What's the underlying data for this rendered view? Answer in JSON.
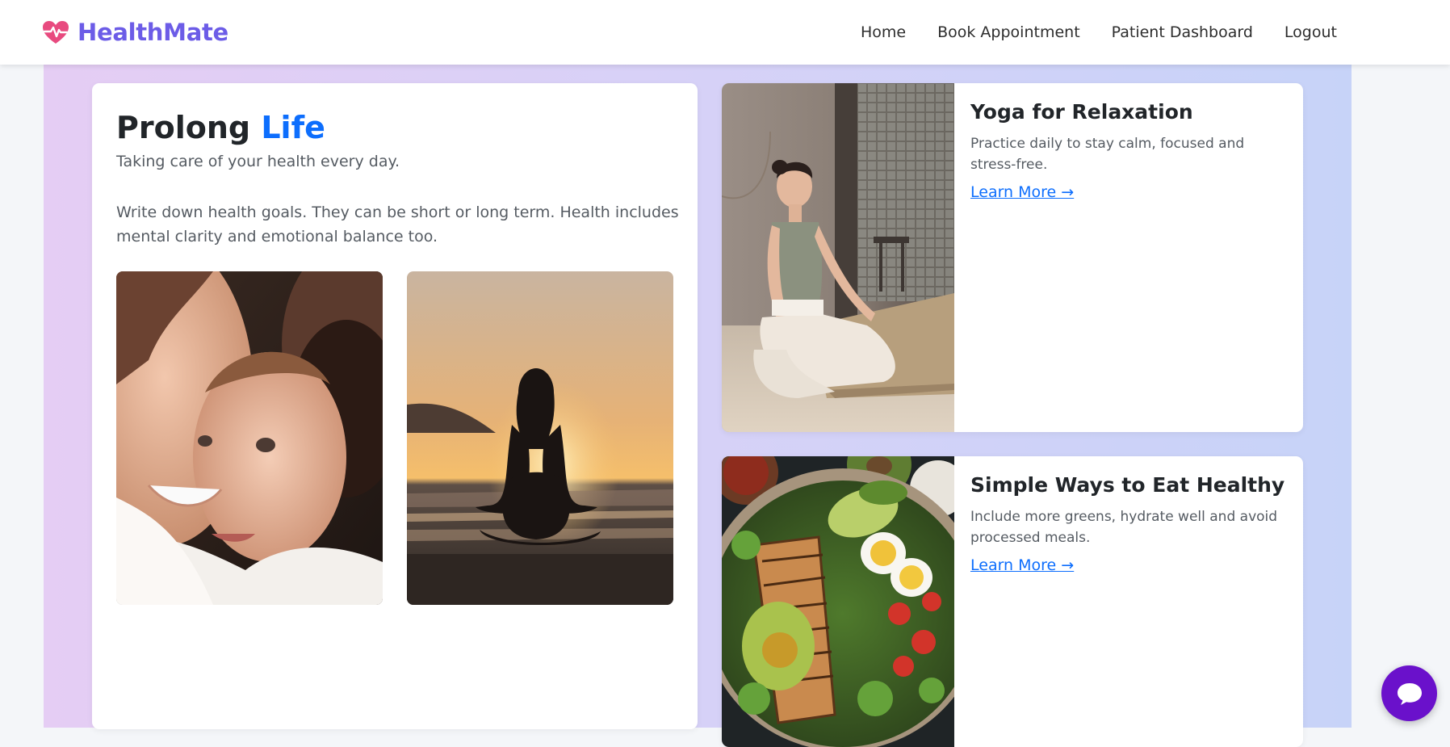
{
  "brand": {
    "name": "HealthMate",
    "icon": "heart-pulse-icon",
    "color": "#6c5ce7",
    "icon_color": "#e84a7f"
  },
  "nav": {
    "items": [
      {
        "label": "Home"
      },
      {
        "label": "Book Appointment"
      },
      {
        "label": "Patient Dashboard"
      },
      {
        "label": "Logout"
      }
    ]
  },
  "hero": {
    "title_plain": "Prolong",
    "title_accent": "Life",
    "subtitle": "Taking care of your health every day.",
    "body": "Write down health goals. They can be short or long term. Health includes mental clarity and emotional balance too.",
    "images": [
      {
        "icon": "family-photo"
      },
      {
        "icon": "meditation-sunset-photo"
      }
    ]
  },
  "articles": [
    {
      "title": "Yoga for Relaxation",
      "text": "Practice daily to stay calm, focused and stress-free.",
      "link": "Learn More →",
      "icon": "yoga-photo"
    },
    {
      "title": "Simple Ways to Eat Healthy",
      "text": "Include more greens, hydrate well and avoid processed meals.",
      "link": "Learn More →",
      "icon": "healthy-food-photo"
    }
  ],
  "chat": {
    "icon": "chat-bubble-icon",
    "color": "#6a11cb"
  },
  "colors": {
    "accent": "#0d6efd",
    "band_start": "#e5cdf4",
    "band_end": "#c7d3f8"
  }
}
